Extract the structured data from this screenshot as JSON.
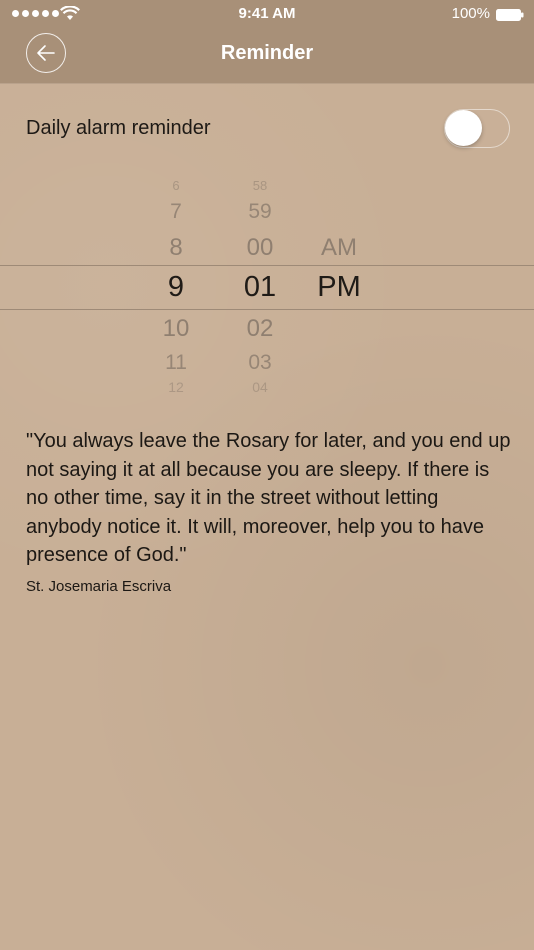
{
  "status_bar": {
    "time": "9:41 AM",
    "battery": "100%"
  },
  "nav": {
    "title": "Reminder",
    "back_icon": "back-arrow-icon"
  },
  "reminder": {
    "label": "Daily alarm reminder",
    "enabled": false
  },
  "picker": {
    "hours": [
      "6",
      "7",
      "8",
      "9",
      "10",
      "11",
      "12"
    ],
    "minutes": [
      "58",
      "59",
      "00",
      "01",
      "02",
      "03",
      "04"
    ],
    "ampm": [
      "AM",
      "PM"
    ],
    "selected": {
      "hour": "9",
      "minute": "01",
      "period": "PM"
    }
  },
  "quote": {
    "text": "\"You always leave the Rosary for later, and you end up not saying it at all because you are sleepy. If there is no other time, say it in the street without letting anybody notice it. It will, moreover, help you to have presence of God.\"",
    "author": "St. Josemaria Escriva"
  },
  "colors": {
    "header": "#a89078",
    "background": "#c8af96",
    "text": "#1c1814"
  }
}
